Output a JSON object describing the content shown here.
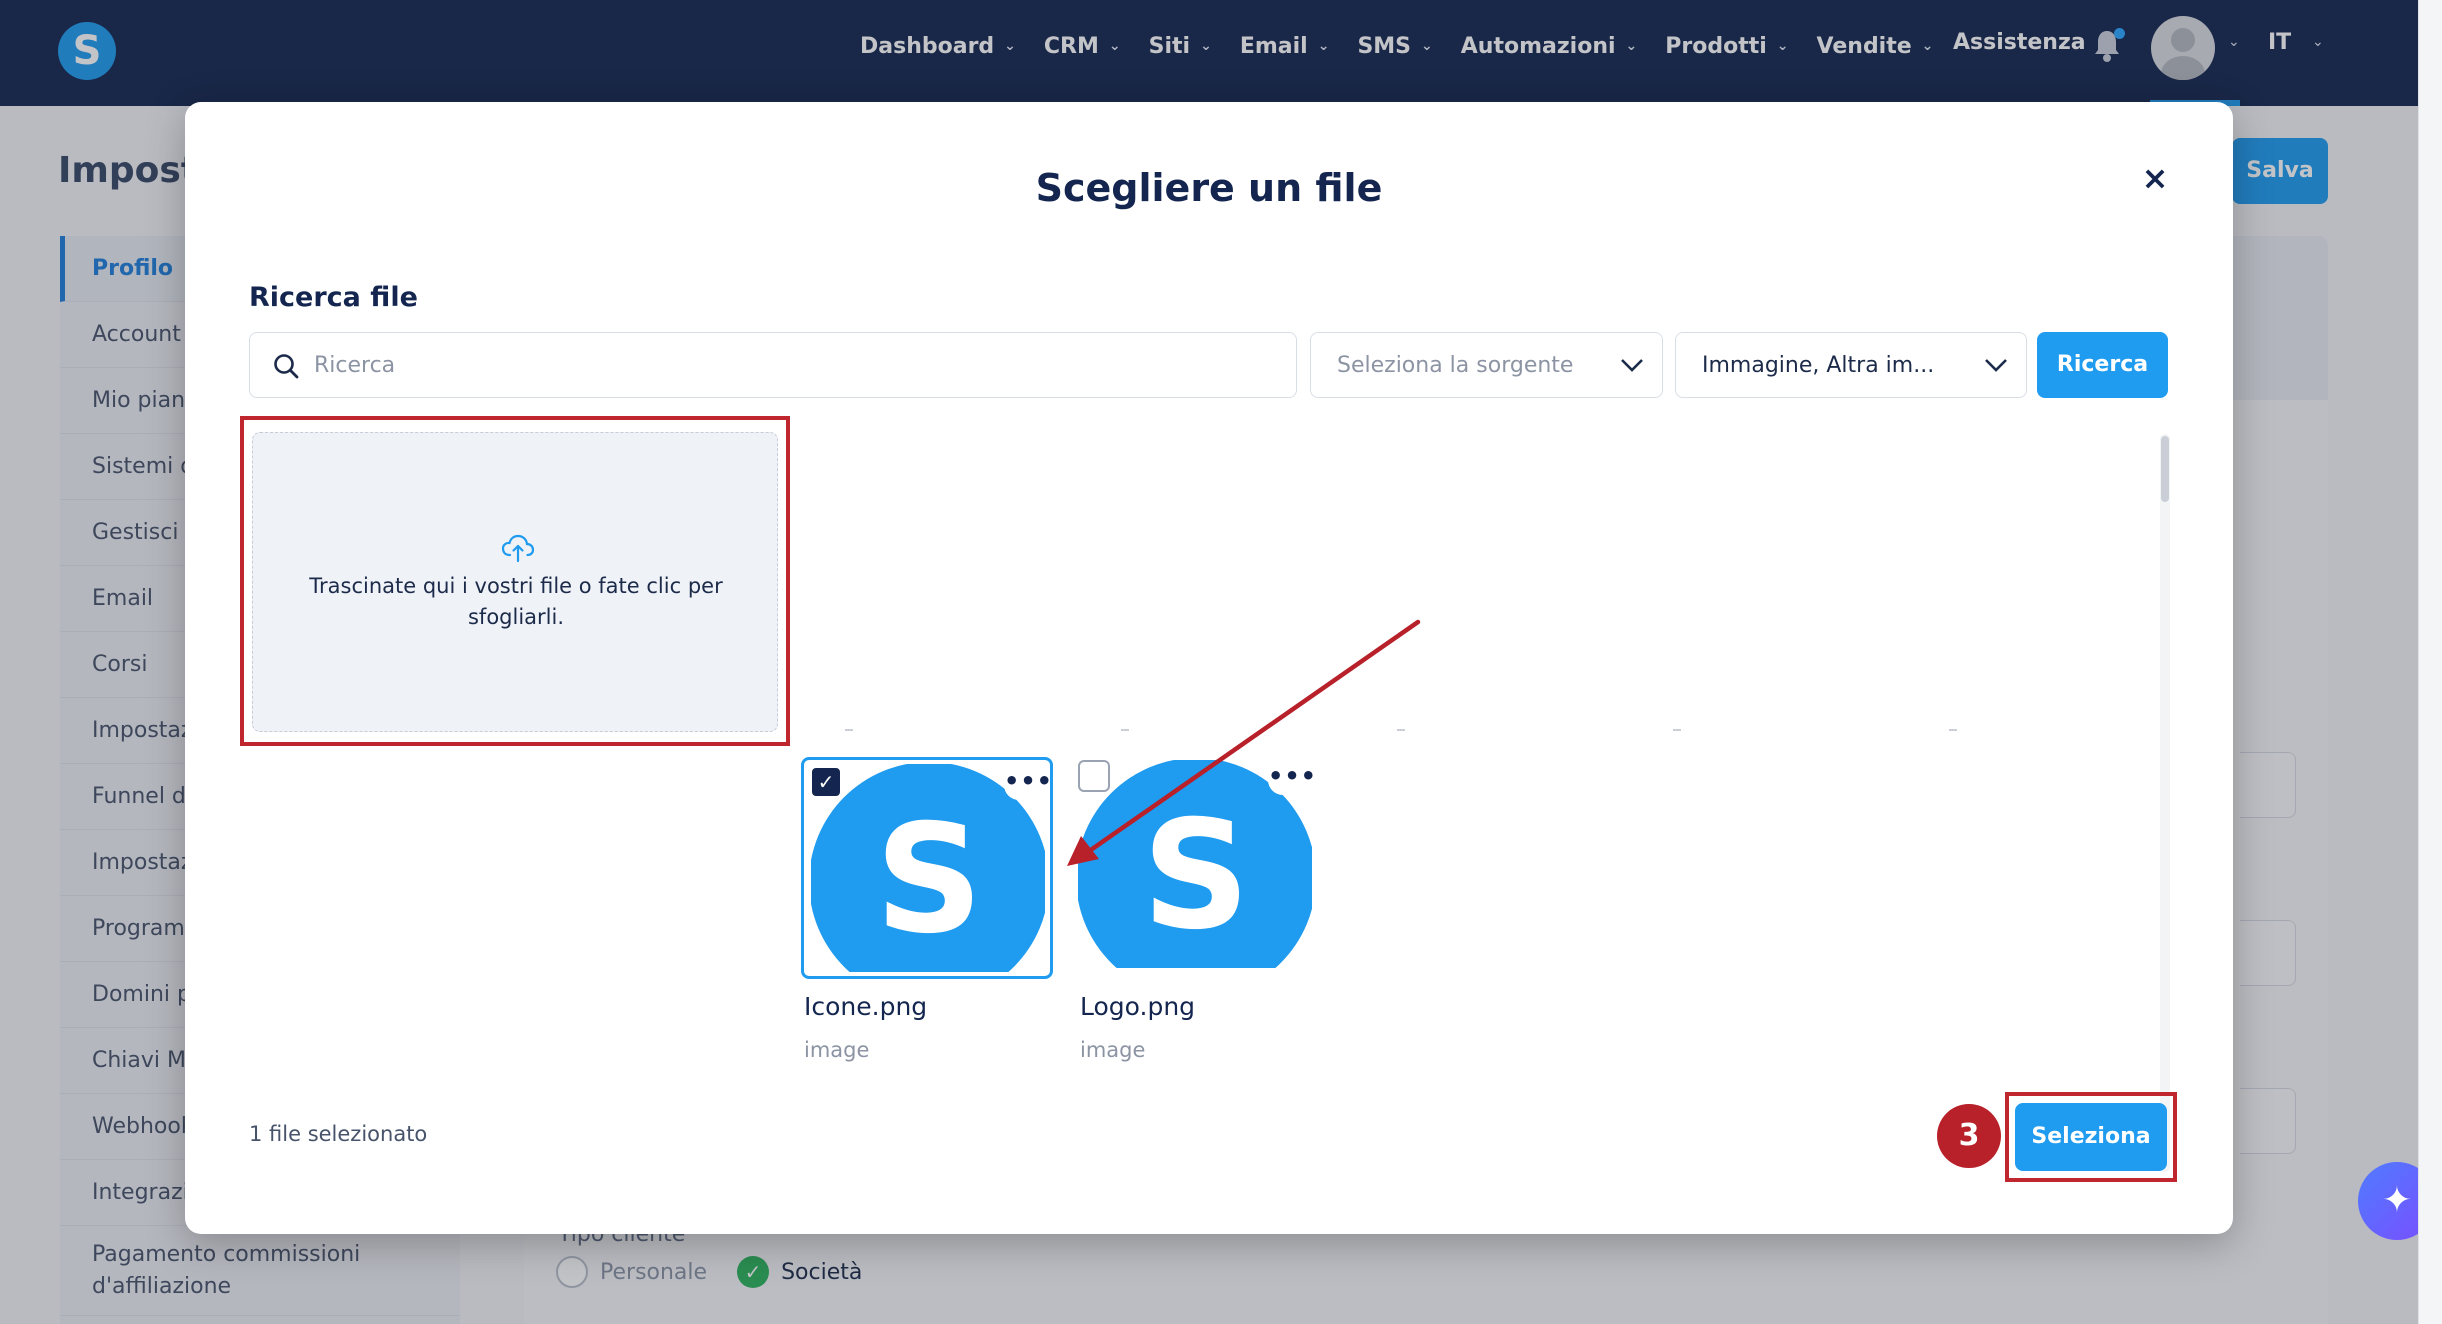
{
  "nav": {
    "brand_letter": "S",
    "items": [
      {
        "label": "Dashboard"
      },
      {
        "label": "CRM"
      },
      {
        "label": "Siti"
      },
      {
        "label": "Email"
      },
      {
        "label": "SMS"
      },
      {
        "label": "Automazioni"
      },
      {
        "label": "Prodotti"
      },
      {
        "label": "Vendite"
      }
    ],
    "assist_label": "Assistenza",
    "lang": "IT"
  },
  "background": {
    "page_title": "Imposta",
    "save_label": "Salva",
    "sidebar": [
      {
        "label": "Profilo",
        "active": true
      },
      {
        "label": "Account"
      },
      {
        "label": "Mio piano"
      },
      {
        "label": "Sistemi d"
      },
      {
        "label": "Gestisci i"
      },
      {
        "label": "Email"
      },
      {
        "label": "Corsi"
      },
      {
        "label": "Impostaz"
      },
      {
        "label": "Funnel di"
      },
      {
        "label": "Impostaz"
      },
      {
        "label": "Program"
      },
      {
        "label": "Domini p"
      },
      {
        "label": "Chiavi M"
      },
      {
        "label": "Webhook"
      },
      {
        "label": "Integrazi"
      },
      {
        "label": "Pagamento commissioni d'affiliazione"
      }
    ],
    "tipo_label": "Tipo cliente",
    "radio_personale": "Personale",
    "radio_societa": "Società"
  },
  "modal": {
    "title": "Scegliere un file",
    "close_glyph": "×",
    "section_label": "Ricerca file",
    "search_placeholder": "Ricerca",
    "source_select": "Seleziona la sorgente",
    "type_select": "Immagine, Altra im...",
    "search_button": "Ricerca",
    "dropzone_text": "Trascinate qui i vostri file o fate clic per sfogliarli.",
    "files": [
      {
        "name": "Icone.png",
        "type": "image",
        "selected": true,
        "thumb_letter": "S"
      },
      {
        "name": "Logo.png",
        "type": "image",
        "selected": false,
        "thumb_letter": "S"
      }
    ],
    "status": "1 file selezionato",
    "step_number": "3",
    "select_button": "Seleziona"
  },
  "icons": {
    "search": "search-icon",
    "chevron": "chevron-down-icon",
    "bell": "bell-icon",
    "upload": "cloud-upload-icon",
    "more": "more-horizontal-icon",
    "check": "check-icon",
    "sparkle": "sparkle-icon"
  },
  "colors": {
    "nav_bg": "#14264f",
    "accent": "#1f9bf0",
    "annotation_red": "#c0262d",
    "success": "#2bb35c"
  }
}
